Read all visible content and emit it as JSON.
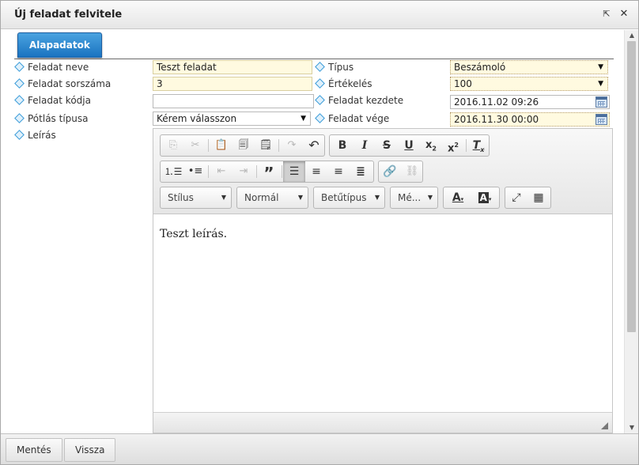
{
  "window": {
    "title": "Új feladat felvitele",
    "popout_icon": "popout-icon",
    "close_icon": "close-icon"
  },
  "tabs": [
    {
      "label": "Alapadatok",
      "active": true
    }
  ],
  "form": {
    "task_name": {
      "label": "Feladat neve",
      "value": "Teszt feladat"
    },
    "task_number": {
      "label": "Feladat sorszáma",
      "value": "3"
    },
    "task_code": {
      "label": "Feladat kódja",
      "value": ""
    },
    "makeup_type": {
      "label": "Pótlás típusa",
      "value": "Kérem válasszon"
    },
    "description": {
      "label": "Leírás"
    },
    "type": {
      "label": "Típus",
      "value": "Beszámoló"
    },
    "rating": {
      "label": "Értékelés",
      "value": "100"
    },
    "start": {
      "label": "Feladat kezdete",
      "value": "2016.11.02 09:26"
    },
    "end": {
      "label": "Feladat vége",
      "value": "2016.11.30 00:00"
    }
  },
  "editor": {
    "combos": {
      "style": "Stílus",
      "format": "Normál",
      "font": "Betűtípus",
      "size": "Mé..."
    },
    "content": "Teszt leírás."
  },
  "footer": {
    "save_label": "Mentés",
    "back_label": "Vissza"
  },
  "colors": {
    "tab_accent": "#1a73c0",
    "required_field_bg": "#fffae0"
  }
}
